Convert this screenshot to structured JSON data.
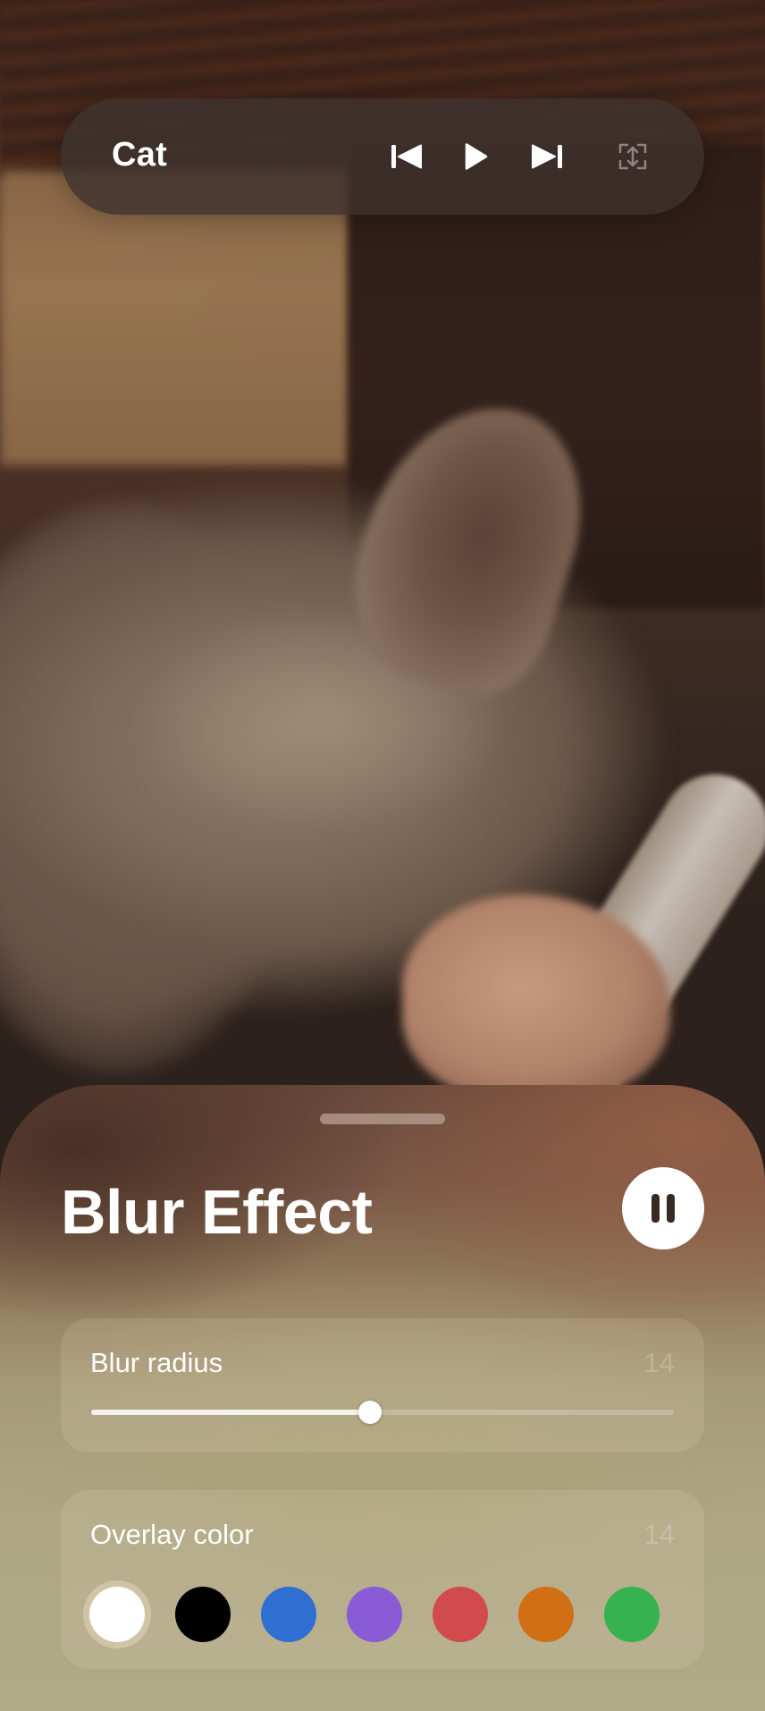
{
  "player": {
    "title": "Cat",
    "controls": [
      {
        "name": "previous-track",
        "icon": "skip-back-icon"
      },
      {
        "name": "play",
        "icon": "play-icon"
      },
      {
        "name": "next-track",
        "icon": "skip-forward-icon"
      },
      {
        "name": "picture-in-picture",
        "icon": "pip-icon"
      }
    ]
  },
  "sheet": {
    "title": "Blur Effect",
    "toggle_icon": "pause-icon",
    "blur": {
      "label": "Blur radius",
      "value": "14",
      "fraction": 0.478
    },
    "overlay": {
      "label": "Overlay color",
      "value": "14",
      "selected_index": 0,
      "colors": [
        "#ffffff",
        "#000000",
        "#2f6fd1",
        "#8a5bd6",
        "#d04a4e",
        "#d06f14",
        "#36b24e"
      ]
    }
  }
}
